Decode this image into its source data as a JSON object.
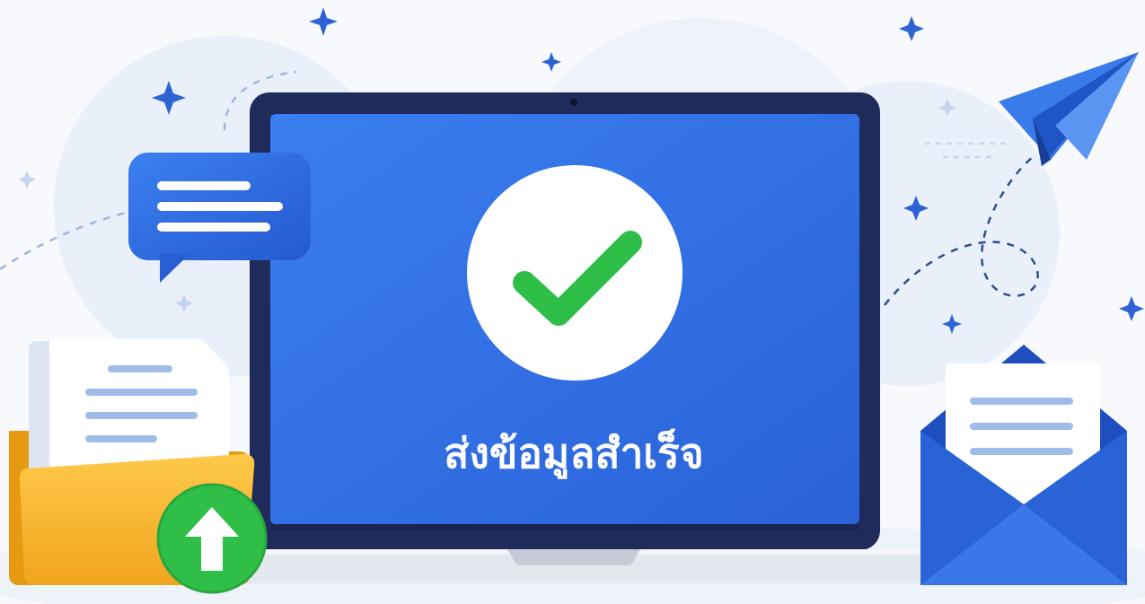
{
  "message": {
    "text": "ส่งข้อมูลสำเร็จ",
    "color": "#ffffff"
  },
  "colors": {
    "screen_blue": "#2f6fe0",
    "bezel": "#1f2b5a",
    "success_green": "#2fbf48",
    "folder_yellow": "#f6b52c",
    "envelope_blue": "#2a63d6",
    "plane_blue": "#3a7bea",
    "sparkle_blue": "#2e63d4"
  },
  "icons": [
    "checkmark-icon",
    "chat-bubble-icon",
    "document-icon",
    "folder-icon",
    "upload-arrow-icon",
    "envelope-icon",
    "letter-icon",
    "paper-plane-icon",
    "sparkle-icon"
  ]
}
